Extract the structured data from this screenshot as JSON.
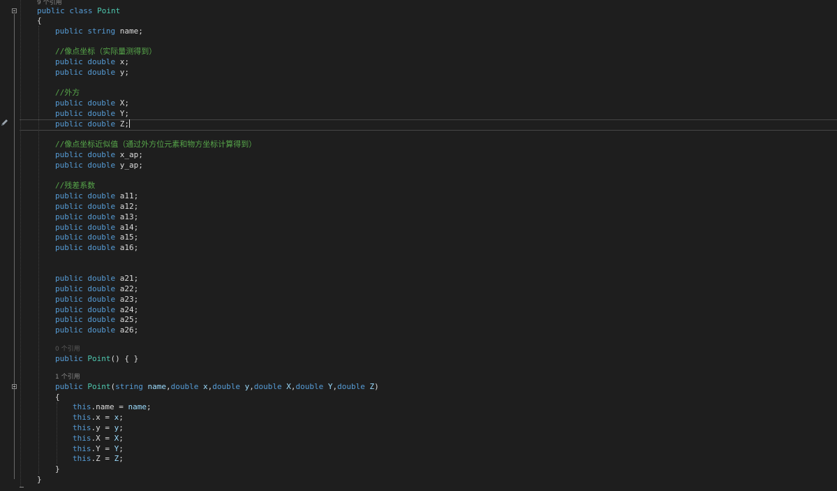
{
  "editor": {
    "class_ref_hint": "9 个引用",
    "class_kw": "public",
    "class_kw2": "class",
    "class_name": "Point",
    "open_brace": "{",
    "close_brace": "}",
    "field_name": {
      "mods": "public",
      "type": "string",
      "rest": " name;"
    },
    "comment_pixel": "//像点坐标（实际量测得到）",
    "fields_pixel": [
      {
        "mods": "public",
        "type": "double",
        "rest": " x;"
      },
      {
        "mods": "public",
        "type": "double",
        "rest": " y;"
      }
    ],
    "comment_outer": "//外方",
    "fields_outer": [
      {
        "mods": "public",
        "type": "double",
        "rest": " X;"
      },
      {
        "mods": "public",
        "type": "double",
        "rest": " Y;"
      },
      {
        "mods": "public",
        "type": "double",
        "rest": " Z;"
      }
    ],
    "comment_approx": "//像点坐标近似值（通过外方位元素和物方坐标计算得到）",
    "fields_approx": [
      {
        "mods": "public",
        "type": "double",
        "rest": " x_ap;"
      },
      {
        "mods": "public",
        "type": "double",
        "rest": " y_ap;"
      }
    ],
    "comment_resid": "//残差系数",
    "fields_a1": [
      {
        "mods": "public",
        "type": "double",
        "rest": " a11;"
      },
      {
        "mods": "public",
        "type": "double",
        "rest": " a12;"
      },
      {
        "mods": "public",
        "type": "double",
        "rest": " a13;"
      },
      {
        "mods": "public",
        "type": "double",
        "rest": " a14;"
      },
      {
        "mods": "public",
        "type": "double",
        "rest": " a15;"
      },
      {
        "mods": "public",
        "type": "double",
        "rest": " a16;"
      }
    ],
    "fields_a2": [
      {
        "mods": "public",
        "type": "double",
        "rest": " a21;"
      },
      {
        "mods": "public",
        "type": "double",
        "rest": " a22;"
      },
      {
        "mods": "public",
        "type": "double",
        "rest": " a23;"
      },
      {
        "mods": "public",
        "type": "double",
        "rest": " a24;"
      },
      {
        "mods": "public",
        "type": "double",
        "rest": " a25;"
      },
      {
        "mods": "public",
        "type": "double",
        "rest": " a26;"
      }
    ],
    "ctor0_hint": "0 个引用",
    "ctor0": {
      "mod": "public",
      "name": "Point",
      "rest": "() { }"
    },
    "ctor1_hint": "1 个引用",
    "ctor1": {
      "mod": "public",
      "name": "Point",
      "p0": "(",
      "t1": "string",
      "n1": " name",
      "t2": "double",
      "n2": " x",
      "t3": "double",
      "n3": " y",
      "t4": "double",
      "n4": " X",
      "t5": "double",
      "n5": " Y",
      "t6": "double",
      "n6": " Z",
      "p1": ")",
      "sep": ","
    },
    "body": [
      {
        "kw": "this",
        "lhs": ".name = ",
        "rhs": "name",
        "end": ";"
      },
      {
        "kw": "this",
        "lhs": ".x = ",
        "rhs": "x",
        "end": ";"
      },
      {
        "kw": "this",
        "lhs": ".y = ",
        "rhs": "y",
        "end": ";"
      },
      {
        "kw": "this",
        "lhs": ".X = ",
        "rhs": "X",
        "end": ";"
      },
      {
        "kw": "this",
        "lhs": ".Y = ",
        "rhs": "Y",
        "end": ";"
      },
      {
        "kw": "this",
        "lhs": ".Z = ",
        "rhs": "Z",
        "end": ";"
      }
    ]
  },
  "colors": {
    "background": "#1e1e1e",
    "keyword": "#569cd6",
    "type": "#4ec9b0",
    "comment": "#57a64a",
    "parameter": "#9cdcfe",
    "text": "#dcdcdc"
  },
  "icons": [
    "pencil-icon",
    "fold-collapse-icon"
  ]
}
